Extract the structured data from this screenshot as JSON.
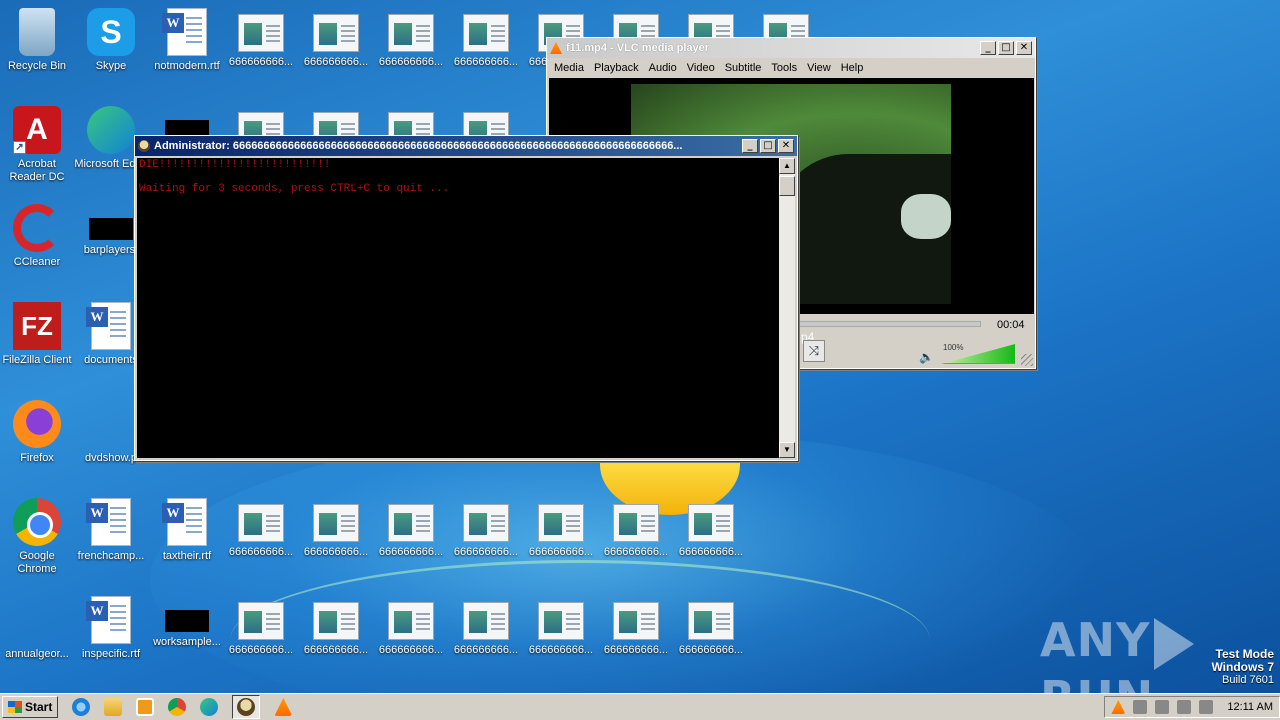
{
  "desktop": {
    "icons": [
      {
        "label": "Recycle Bin"
      },
      {
        "label": "Skype"
      },
      {
        "label": "notmodern.rtf"
      },
      {
        "label": "666666666..."
      },
      {
        "label": "Acrobat Reader DC"
      },
      {
        "label": "Microsoft Edge"
      },
      {
        "label": "CCleaner"
      },
      {
        "label": "barplayers."
      },
      {
        "label": "FileZilla Client"
      },
      {
        "label": "documents"
      },
      {
        "label": "Firefox"
      },
      {
        "label": "dvdshow.p"
      },
      {
        "label": "Google Chrome"
      },
      {
        "label": "frenchcamp..."
      },
      {
        "label": "taxtheir.rtf"
      },
      {
        "label": "annualgeor..."
      },
      {
        "label": "inspecific.rtf"
      },
      {
        "label": "worksample..."
      }
    ]
  },
  "vlc": {
    "title": "f11.mp4 - VLC media player",
    "menu": [
      "Media",
      "Playback",
      "Audio",
      "Video",
      "Subtitle",
      "Tools",
      "View",
      "Help"
    ],
    "time": "00:04",
    "volume_label": "100%",
    "volume_fraction": 1.0,
    "overlay_text": "p4"
  },
  "console": {
    "title": "Administrator:  666666666666666666666666666666666666666666666666666666666666666666666666...",
    "line1": "DIE!!!!!!!!!!!!!!!!!!!!!!!!!!",
    "line2": "Waiting for 3 seconds, press CTRL+C to quit ..."
  },
  "watermark": {
    "left": "ANY",
    "right": "RUN"
  },
  "test_mode": {
    "line1": "Test Mode",
    "line2": "Windows 7",
    "line3": "Build 7601"
  },
  "taskbar": {
    "start_label": "Start",
    "clock": "12:11 AM"
  },
  "colors": {
    "console_text": "#b01010",
    "titlebar_active": "#0a246a"
  }
}
